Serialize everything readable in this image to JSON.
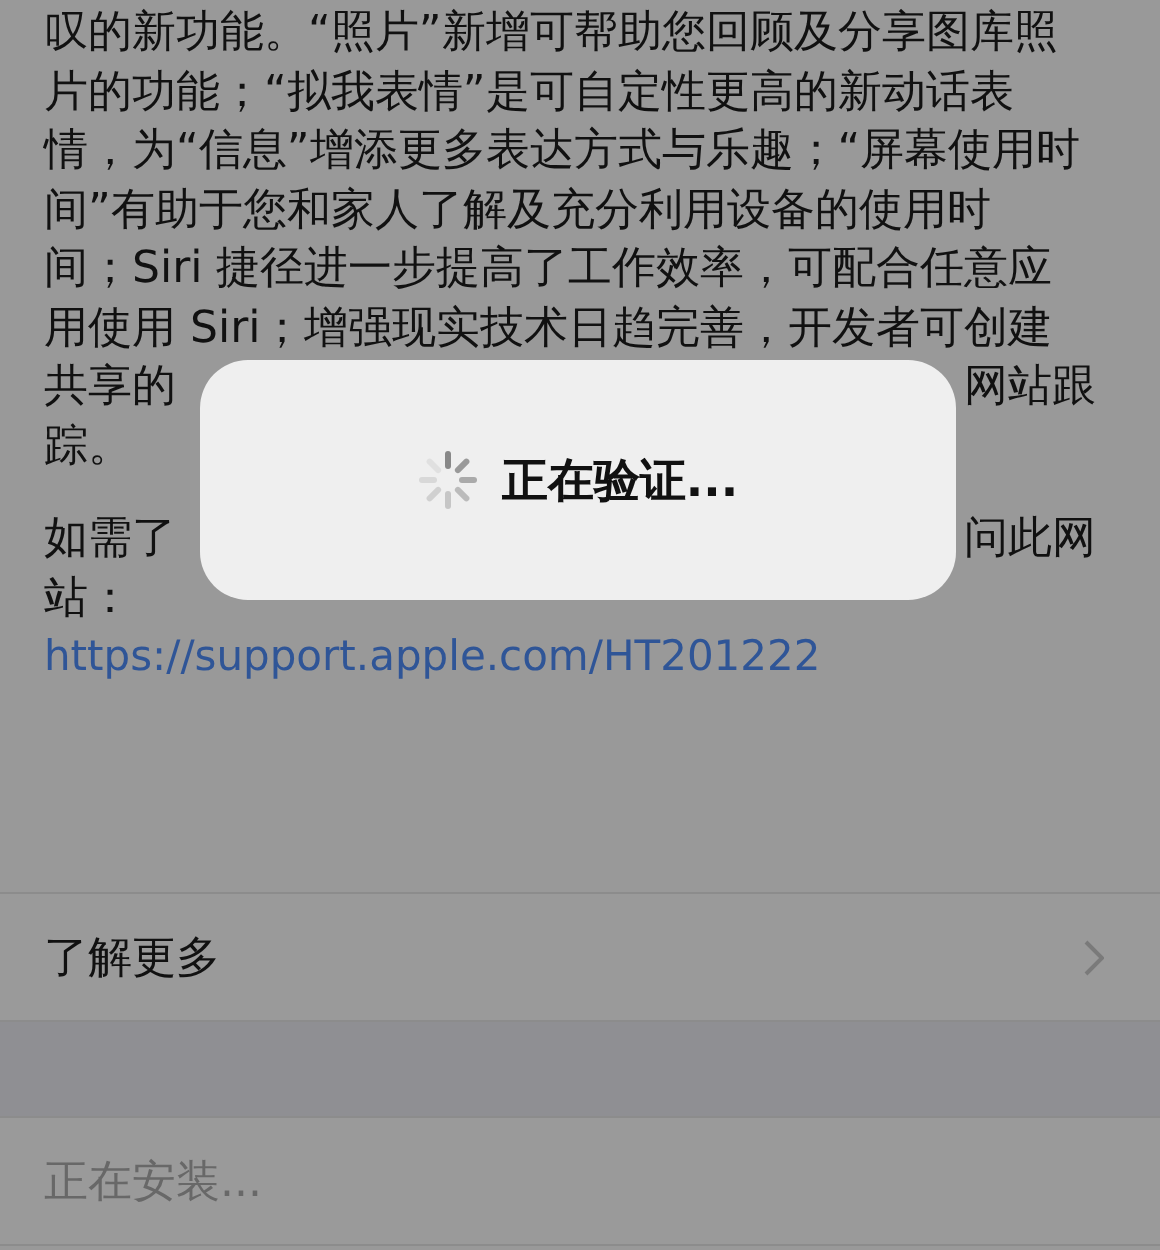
{
  "description": {
    "paragraphs": [
      {
        "lines": [
          {
            "left": "叹的新功能。“照片”新增可帮助您回顾及分享图库照"
          },
          {
            "left": "片的功能；“拟我表情”是可自定性更高的新动话表"
          },
          {
            "left": "情，为“信息”增添更多表达方式与乐趣；“屏幕使用时"
          },
          {
            "left": "间”有助于您和家人了解及充分利用设备的使用时"
          },
          {
            "left": "间；Siri 捷径进一步提高了工作效率，可配合任意应"
          },
          {
            "left": "用使用 Siri；增强现实技术日趋完善，开发者可创建"
          },
          {
            "left": "共享的",
            "right": "网站跟"
          },
          {
            "left": "踪。"
          }
        ]
      },
      {
        "lines": [
          {
            "left": "如需了",
            "right": "问此网"
          },
          {
            "left": "站："
          }
        ]
      }
    ],
    "link": "https://support.apple.com/HT201222"
  },
  "rows": [
    {
      "label": "了解更多",
      "kind": "link",
      "disabled": false
    },
    {
      "label": "正在安装...",
      "kind": "status",
      "disabled": true
    }
  ],
  "alert": {
    "text": "正在验证...",
    "spinner": true
  }
}
